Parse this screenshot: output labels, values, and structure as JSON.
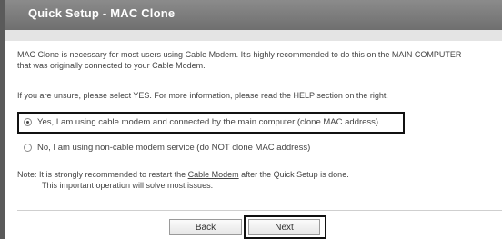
{
  "header": {
    "title": "Quick Setup - MAC Clone"
  },
  "intro": {
    "line1": "MAC Clone is necessary for most users using Cable Modem. It's highly recommended to do this on the MAIN COMPUTER",
    "line2": "that was originally connected to your Cable Modem.",
    "line3": "If you are unsure, please select YES. For more information, please read the HELP section on the right."
  },
  "options": {
    "yes": {
      "label": "Yes, I am using cable modem and connected by the main computer (clone MAC address)",
      "selected": true
    },
    "no": {
      "label": "No, I am using non-cable modem service (do NOT clone MAC address)",
      "selected": false
    }
  },
  "note": {
    "prefix": "Note: It is strongly recommended to restart the ",
    "link": "Cable Modem",
    "suffix": " after the Quick Setup is done.",
    "line2": "This important operation will solve most issues."
  },
  "buttons": {
    "back": "Back",
    "next": "Next"
  }
}
